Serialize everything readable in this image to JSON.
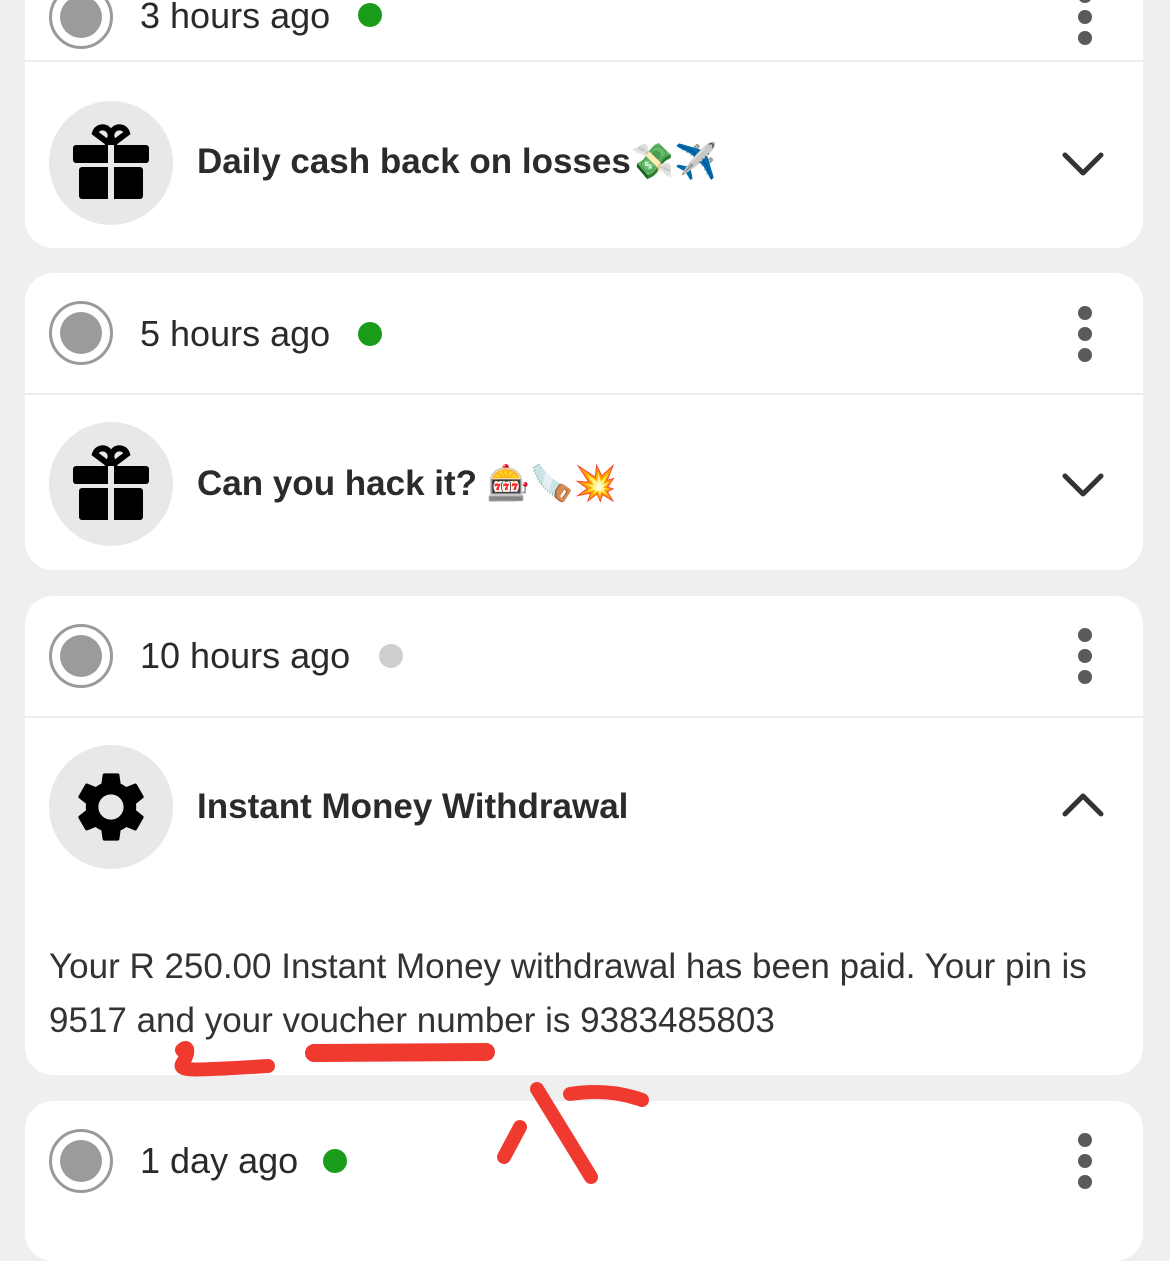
{
  "notifications": [
    {
      "time": "3 hours ago",
      "status": "unread",
      "title": "Daily cash back on losses💸✈️"
    },
    {
      "time": "5 hours ago",
      "status": "unread",
      "title": "Can you hack it? 🎰🪚💥"
    },
    {
      "time": "10 hours ago",
      "status": "read",
      "title": "Instant Money Withdrawal",
      "body": "Your R 250.00 Instant Money withdrawal has been paid. Your pin is 9517 and your voucher number is 9383485803"
    },
    {
      "time": "1 day ago",
      "status": "unread"
    }
  ],
  "icons": {
    "radio": "radio-icon",
    "more": "more-vert-icon",
    "gift": "gift-icon",
    "settings": "gear-icon",
    "expand": "chevron-down-icon",
    "collapse": "chevron-up-icon"
  },
  "colors": {
    "unread_dot": "#1a9c1a",
    "read_dot": "#cfcfcf",
    "annotation": "#f03a30",
    "background": "#efefef",
    "card": "#ffffff"
  }
}
